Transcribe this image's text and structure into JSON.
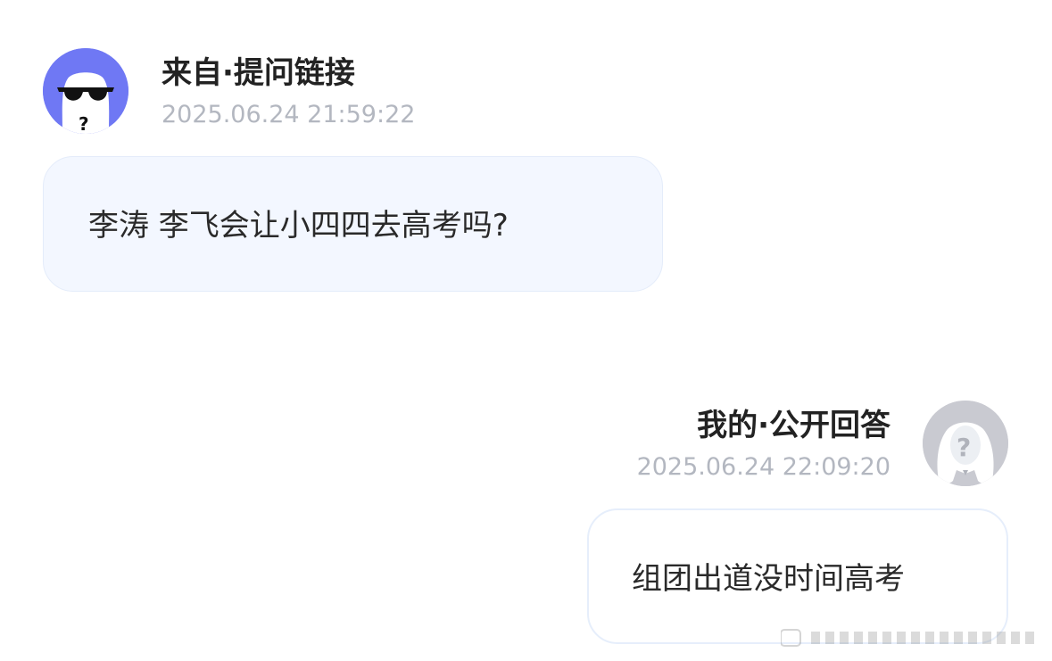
{
  "question": {
    "source_label": "来自·提问链接",
    "timestamp": "2025.06.24 21:59:22",
    "text": "李涛 李飞会让小四四去高考吗?",
    "avatar_icon": "anonymous-sunglasses-avatar-icon",
    "avatar_color": "#6f78f4"
  },
  "answer": {
    "source_label": "我的·公开回答",
    "timestamp": "2025.06.24 22:09:20",
    "text": "组团出道没时间高考",
    "avatar_icon": "question-mark-avatar-icon",
    "avatar_color": "#c9cad1"
  },
  "colors": {
    "question_bubble_bg": "#f3f7ff",
    "timestamp_text": "#b3b7c0"
  }
}
